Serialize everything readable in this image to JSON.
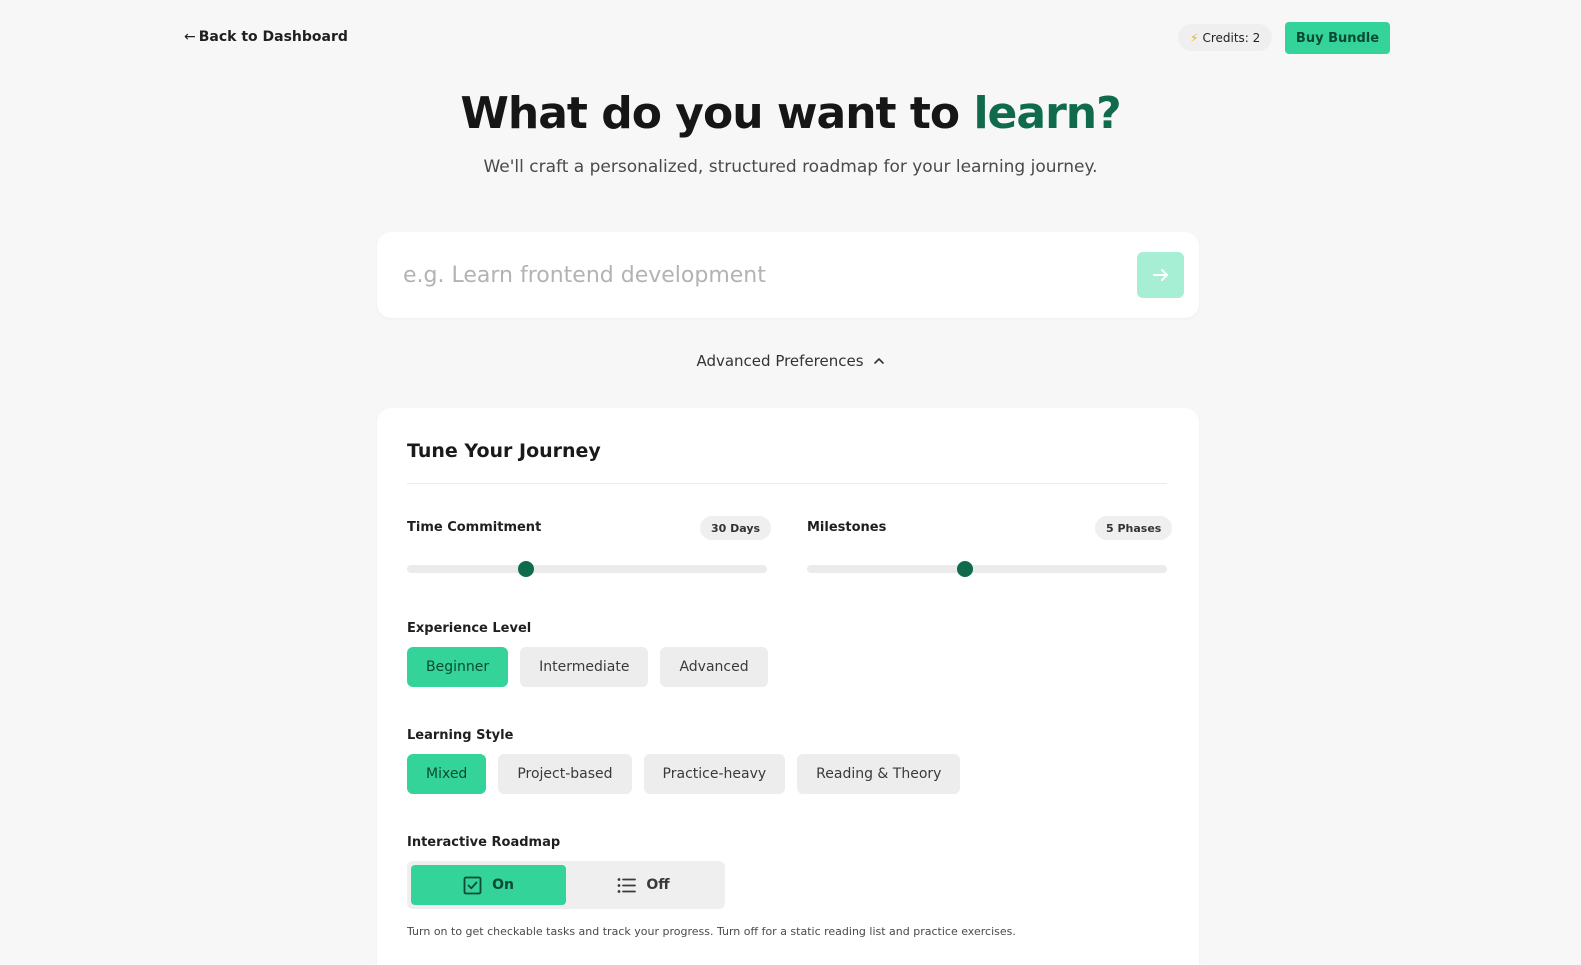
{
  "nav": {
    "back_label": "Back to Dashboard",
    "back_arrow": "←",
    "credits_label": "Credits: 2",
    "buy_label": "Buy Bundle"
  },
  "hero": {
    "title_main": "What do you want to ",
    "title_accent": "learn?",
    "subtitle": "We'll craft a personalized, structured roadmap for your learning journey."
  },
  "search": {
    "value": "",
    "placeholder": "e.g. Learn frontend development"
  },
  "advanced": {
    "label": "Advanced Preferences",
    "expanded": true
  },
  "panel": {
    "title": "Tune Your Journey",
    "time": {
      "label": "Time Commitment",
      "value_label": "30 Days",
      "level": 0.33
    },
    "milestones": {
      "label": "Milestones",
      "value_label": "5 Phases",
      "level": 0.44
    },
    "experience": {
      "label": "Experience Level",
      "options": [
        "Beginner",
        "Intermediate",
        "Advanced"
      ],
      "selected": "Beginner"
    },
    "style": {
      "label": "Learning Style",
      "options": [
        "Mixed",
        "Project-based",
        "Practice-heavy",
        "Reading & Theory"
      ],
      "selected": "Mixed"
    },
    "interactive": {
      "label": "Interactive Roadmap",
      "on_label": "On",
      "off_label": "Off",
      "selected": "On",
      "help": "Turn on to get checkable tasks and track your progress. Turn off for a static reading list and practice exercises."
    }
  },
  "colors": {
    "accent": "#34d399",
    "accent_dark": "#0f6b4b",
    "background": "#f7f7f7"
  },
  "icons": [
    "back-arrow-icon",
    "lightning-bolt-icon",
    "arrow-right-icon",
    "chevron-up-icon",
    "checkbox-icon",
    "list-icon"
  ]
}
